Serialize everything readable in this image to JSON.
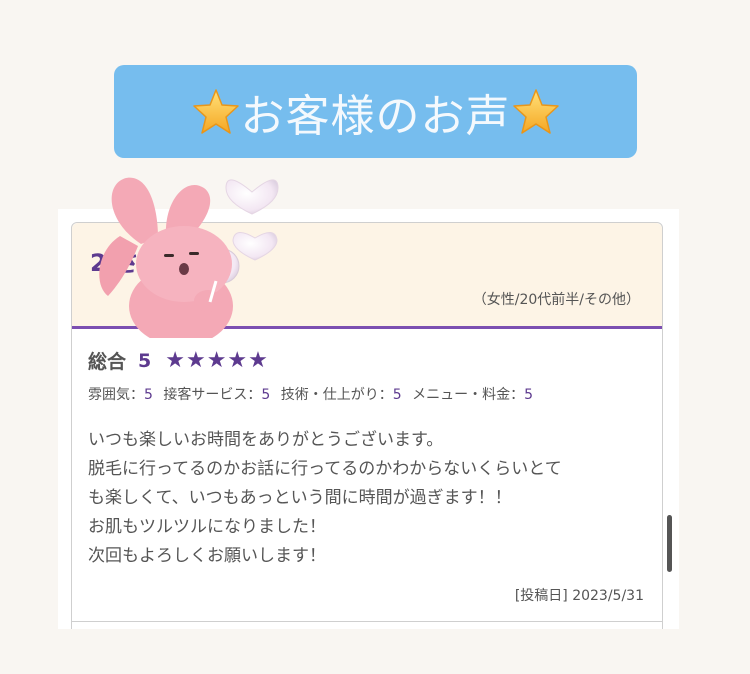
{
  "banner": {
    "title": "お客様のお声",
    "star_icon": "star-icon"
  },
  "review": {
    "reviewer_name": "2 さん",
    "reviewer_meta": "（女性/20代前半/その他）",
    "overall": {
      "label": "総合",
      "score": "5",
      "stars": "★★★★★",
      "rating": 5
    },
    "sub_ratings": [
      {
        "label": "雰囲気：",
        "value": "5"
      },
      {
        "label": "接客サービス：",
        "value": "5"
      },
      {
        "label": "技術・仕上がり：",
        "value": "5"
      },
      {
        "label": "メニュー・料金：",
        "value": "5"
      }
    ],
    "comment_lines": [
      "いつも楽しいお時間をありがとうございます。",
      "脱毛に行ってるのかお話に行ってるのかわからないくらいとて",
      "も楽しくて、いつもあっという間に時間が過ぎます！！",
      "お肌もツルツルになりました！",
      "次回もよろしくお願いします！"
    ],
    "post_date": "[投稿日] 2023/5/31"
  },
  "colors": {
    "banner": "#76bdee",
    "accent_purple": "#5d3a8f",
    "header_bg": "#fdf4e6",
    "page_bg": "#f9f6f2"
  },
  "decor": {
    "mascot": "pink-bunny-sticker-with-bubble-hearts"
  }
}
